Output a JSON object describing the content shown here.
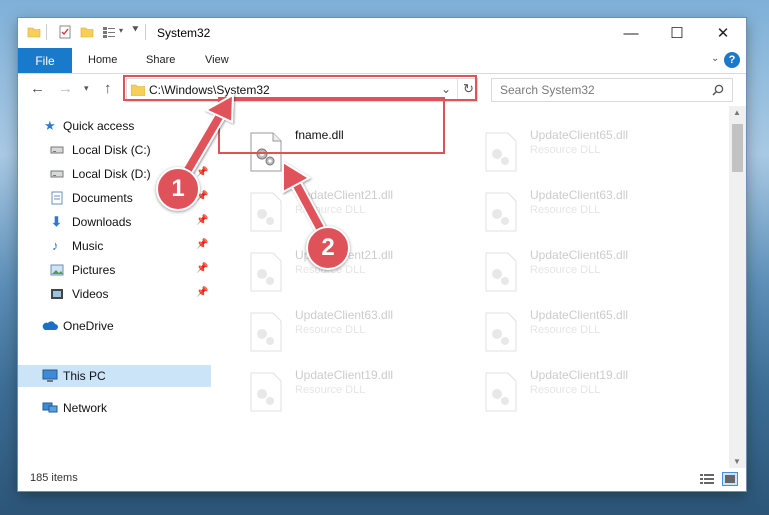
{
  "window": {
    "title": "System32",
    "minimize": "—",
    "maximize": "☐",
    "close": "✕"
  },
  "ribbon": {
    "tabs": [
      "File",
      "Home",
      "Share",
      "View"
    ],
    "help": "?"
  },
  "address": {
    "path": "C:\\Windows\\System32",
    "search_placeholder": "Search System32"
  },
  "sidebar": {
    "items": [
      {
        "label": "Quick access",
        "icon": "star-icon"
      },
      {
        "label": "Local Disk (C:)",
        "icon": "drive-icon",
        "pinned": true
      },
      {
        "label": "Local Disk (D:)",
        "icon": "drive-icon",
        "pinned": true
      },
      {
        "label": "Documents",
        "icon": "documents-icon",
        "pinned": true
      },
      {
        "label": "Downloads",
        "icon": "downloads-icon",
        "pinned": true
      },
      {
        "label": "Music",
        "icon": "music-icon",
        "pinned": true
      },
      {
        "label": "Pictures",
        "icon": "pictures-icon",
        "pinned": true
      },
      {
        "label": "Videos",
        "icon": "videos-icon",
        "pinned": true
      },
      {
        "label": "OneDrive",
        "icon": "onedrive-icon"
      },
      {
        "label": "This PC",
        "icon": "computer-icon",
        "selected": true
      },
      {
        "label": "Network",
        "icon": "network-icon"
      }
    ]
  },
  "files": [
    {
      "name": "fname.dll",
      "type": ""
    },
    {
      "name": "UpdateClient65.dll",
      "type": "Resource DLL"
    },
    {
      "name": "UpdateClient21.dll",
      "type": "Resource DLL"
    },
    {
      "name": "UpdateClient63.dll",
      "type": "Resource DLL"
    },
    {
      "name": "UpdateClient21.dll",
      "type": "Resource DLL"
    },
    {
      "name": "UpdateClient65.dll",
      "type": "Resource DLL"
    },
    {
      "name": "UpdateClient63.dll",
      "type": "Resource DLL"
    },
    {
      "name": "UpdateClient65.dll",
      "type": "Resource DLL"
    },
    {
      "name": "UpdateClient19.dll",
      "type": "Resource DLL"
    },
    {
      "name": "UpdateClient19.dll",
      "type": "Resource DLL"
    }
  ],
  "status": {
    "item_count": "185 items"
  },
  "annotations": {
    "step1": "1",
    "step2": "2",
    "color": "#e0525a"
  }
}
